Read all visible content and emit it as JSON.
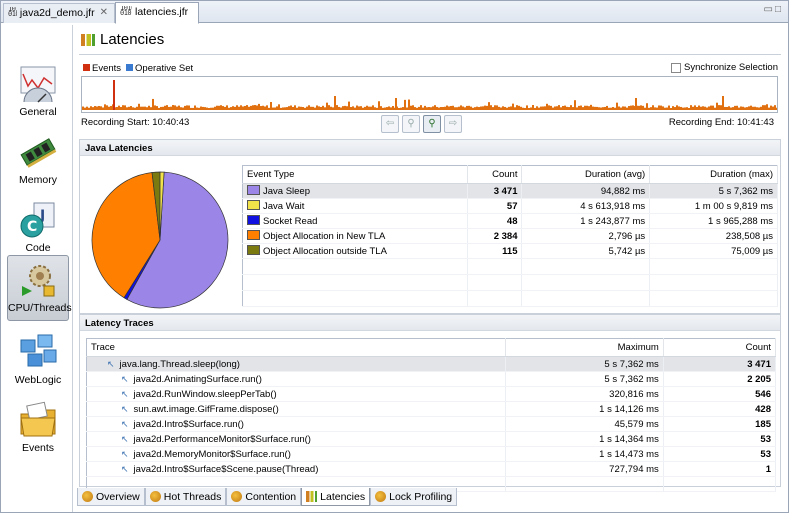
{
  "tabs": [
    {
      "label": "java2d_demo.jfr",
      "closable": true
    },
    {
      "label": "latencies.jfr",
      "closable": false
    }
  ],
  "sidebar": {
    "items": [
      {
        "label": "General",
        "icon": "gauge-chart-icon",
        "selected": false
      },
      {
        "label": "Memory",
        "icon": "memory-chip-icon",
        "selected": false
      },
      {
        "label": "Code",
        "icon": "java-code-icon",
        "selected": false
      },
      {
        "label": "CPU/Threads",
        "icon": "cpu-gears-icon",
        "selected": true
      },
      {
        "label": "WebLogic",
        "icon": "weblogic-cubes-icon",
        "selected": false
      },
      {
        "label": "Events",
        "icon": "events-folder-icon",
        "selected": false
      }
    ]
  },
  "page_title": "Latencies",
  "legend": {
    "events": "Events",
    "operative_set": "Operative Set"
  },
  "sync_selection": "Synchronize Selection",
  "recording": {
    "start": "Recording Start: 10:40:43",
    "end": "Recording End: 10:41:43"
  },
  "java_latencies": {
    "title": "Java Latencies",
    "columns": [
      "Event Type",
      "Count",
      "Duration (avg)",
      "Duration (max)"
    ],
    "rows": [
      {
        "type": "Java Sleep",
        "color": "#9b85e6",
        "count": "3 471",
        "avg": "94,882 ms",
        "max": "5 s 7,362 ms"
      },
      {
        "type": "Java Wait",
        "color": "#f2e24a",
        "count": "57",
        "avg": "4 s 613,918 ms",
        "max": "1 m 00 s 9,819 ms"
      },
      {
        "type": "Socket Read",
        "color": "#1010e0",
        "count": "48",
        "avg": "1 s 243,877 ms",
        "max": "1 s 965,288 ms"
      },
      {
        "type": "Object Allocation in New TLA",
        "color": "#ff8000",
        "count": "2 384",
        "avg": "2,796 µs",
        "max": "238,508 µs"
      },
      {
        "type": "Object Allocation outside TLA",
        "color": "#7a7a10",
        "count": "115",
        "avg": "5,742 µs",
        "max": "75,009 µs"
      }
    ]
  },
  "latency_traces": {
    "title": "Latency Traces",
    "columns": [
      "Trace",
      "Maximum",
      "Count"
    ],
    "rows": [
      {
        "trace": "java.lang.Thread.sleep(long)",
        "max": "5 s 7,362 ms",
        "count": "3 471",
        "level": 0
      },
      {
        "trace": "java2d.AnimatingSurface.run()",
        "max": "5 s 7,362 ms",
        "count": "2 205",
        "level": 1
      },
      {
        "trace": "java2d.RunWindow.sleepPerTab()",
        "max": "320,816 ms",
        "count": "546",
        "level": 1
      },
      {
        "trace": "sun.awt.image.GifFrame.dispose()",
        "max": "1 s 14,126 ms",
        "count": "428",
        "level": 1
      },
      {
        "trace": "java2d.Intro$Surface.run()",
        "max": "45,579 ms",
        "count": "185",
        "level": 1
      },
      {
        "trace": "java2d.PerformanceMonitor$Surface.run()",
        "max": "1 s 14,364 ms",
        "count": "53",
        "level": 1
      },
      {
        "trace": "java2d.MemoryMonitor$Surface.run()",
        "max": "1 s 14,473 ms",
        "count": "53",
        "level": 1
      },
      {
        "trace": "java2d.Intro$Surface$Scene.pause(Thread)",
        "max": "727,794 ms",
        "count": "1",
        "level": 1
      }
    ]
  },
  "bottom_tabs": [
    {
      "label": "Overview",
      "selected": false
    },
    {
      "label": "Hot Threads",
      "selected": false
    },
    {
      "label": "Contention",
      "selected": false
    },
    {
      "label": "Latencies",
      "selected": true
    },
    {
      "label": "Lock Profiling",
      "selected": false
    }
  ],
  "colors": {
    "events_legend": "#d03010",
    "operative_legend": "#3a7ad0",
    "strip_series": "#e07010",
    "java_sleep": "#9b85e6",
    "object_alloc_new_tla": "#ff8000"
  },
  "chart_data": {
    "type": "pie",
    "categories": [
      "Java Sleep",
      "Java Wait",
      "Socket Read",
      "Object Allocation in New TLA",
      "Object Allocation outside TLA"
    ],
    "values": [
      3471,
      57,
      48,
      2384,
      115
    ],
    "colors": [
      "#9b85e6",
      "#f2e24a",
      "#1010e0",
      "#ff8000",
      "#7a7a10"
    ]
  }
}
